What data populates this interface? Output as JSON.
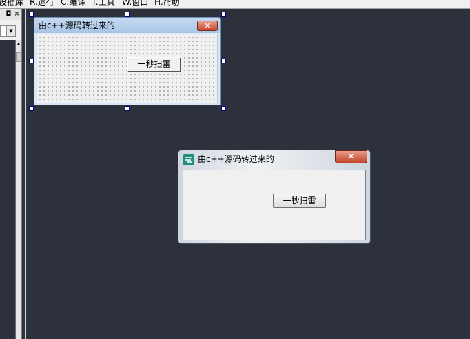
{
  "menubar": {
    "items": [
      {
        "label": "设插库",
        "key": ""
      },
      {
        "label": "R.运行",
        "key": "R"
      },
      {
        "label": "C.编译",
        "key": "C"
      },
      {
        "label": "T.工具",
        "key": "T"
      },
      {
        "label": "W.窗口",
        "key": "W"
      },
      {
        "label": "H.帮助",
        "key": "H"
      }
    ]
  },
  "left_panel": {
    "pin_glyph": "◘",
    "close_glyph": "×",
    "combo_arrow_glyph": "▼",
    "scroll_up_glyph": "▲"
  },
  "design_window": {
    "title": "由c++源码转过来的",
    "close_glyph": "✕",
    "button_label": "一秒扫雷"
  },
  "preview_window": {
    "title": "由c++源码转过来的",
    "close_glyph": "✕",
    "button_label": "一秒扫雷",
    "icon": "app-icon"
  },
  "colors": {
    "workspace": "#2c313c",
    "close_red": "#c9462c",
    "title_blue": "#a8c5e6"
  }
}
